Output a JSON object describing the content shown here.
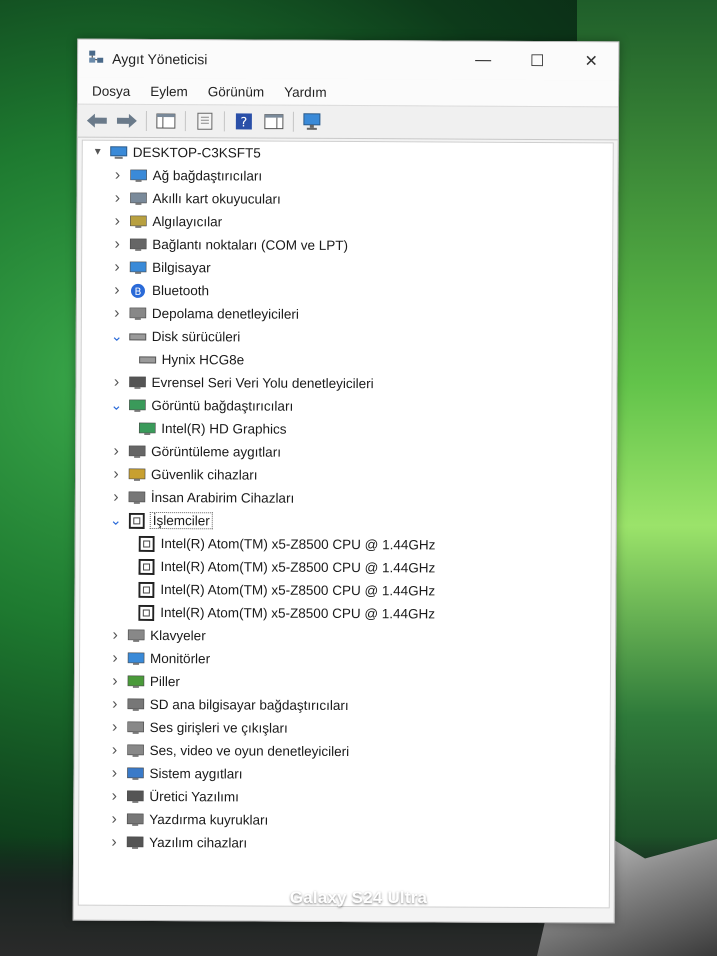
{
  "window": {
    "title": "Aygıt Yöneticisi"
  },
  "menu": [
    "Dosya",
    "Eylem",
    "Görünüm",
    "Yardım"
  ],
  "tree": {
    "root": "DESKTOP-C3KSFT5",
    "items": [
      {
        "label": "Ağ bağdaştırıcıları",
        "level": 1,
        "expanded": false,
        "icon": "network-adapter-icon"
      },
      {
        "label": "Akıllı kart okuyucuları",
        "level": 1,
        "expanded": false,
        "icon": "smart-card-reader-icon"
      },
      {
        "label": "Algılayıcılar",
        "level": 1,
        "expanded": false,
        "icon": "sensor-icon"
      },
      {
        "label": "Bağlantı noktaları (COM ve LPT)",
        "level": 1,
        "expanded": false,
        "icon": "port-icon"
      },
      {
        "label": "Bilgisayar",
        "level": 1,
        "expanded": false,
        "icon": "computer-icon"
      },
      {
        "label": "Bluetooth",
        "level": 1,
        "expanded": false,
        "icon": "bluetooth-icon"
      },
      {
        "label": "Depolama denetleyicileri",
        "level": 1,
        "expanded": false,
        "icon": "storage-controller-icon"
      },
      {
        "label": "Disk sürücüleri",
        "level": 1,
        "expanded": true,
        "icon": "disk-drive-icon"
      },
      {
        "label": "Hynix HCG8e",
        "level": 2,
        "icon": "disk-drive-icon"
      },
      {
        "label": "Evrensel Seri Veri Yolu denetleyicileri",
        "level": 1,
        "expanded": false,
        "icon": "usb-icon"
      },
      {
        "label": "Görüntü bağdaştırıcıları",
        "level": 1,
        "expanded": true,
        "icon": "display-adapter-icon"
      },
      {
        "label": "Intel(R) HD Graphics",
        "level": 2,
        "icon": "display-adapter-icon"
      },
      {
        "label": "Görüntüleme aygıtları",
        "level": 1,
        "expanded": false,
        "icon": "camera-icon"
      },
      {
        "label": "Güvenlik cihazları",
        "level": 1,
        "expanded": false,
        "icon": "security-device-icon"
      },
      {
        "label": "İnsan Arabirim Cihazları",
        "level": 1,
        "expanded": false,
        "icon": "hid-icon"
      },
      {
        "label": "İşlemciler",
        "level": 1,
        "expanded": true,
        "icon": "processor-icon",
        "selected": true
      },
      {
        "label": "Intel(R) Atom(TM) x5-Z8500  CPU @ 1.44GHz",
        "level": 2,
        "icon": "processor-icon"
      },
      {
        "label": "Intel(R) Atom(TM) x5-Z8500  CPU @ 1.44GHz",
        "level": 2,
        "icon": "processor-icon"
      },
      {
        "label": "Intel(R) Atom(TM) x5-Z8500  CPU @ 1.44GHz",
        "level": 2,
        "icon": "processor-icon"
      },
      {
        "label": "Intel(R) Atom(TM) x5-Z8500  CPU @ 1.44GHz",
        "level": 2,
        "icon": "processor-icon"
      },
      {
        "label": "Klavyeler",
        "level": 1,
        "expanded": false,
        "icon": "keyboard-icon"
      },
      {
        "label": "Monitörler",
        "level": 1,
        "expanded": false,
        "icon": "monitor-icon"
      },
      {
        "label": "Piller",
        "level": 1,
        "expanded": false,
        "icon": "battery-icon"
      },
      {
        "label": "SD ana bilgisayar bağdaştırıcıları",
        "level": 1,
        "expanded": false,
        "icon": "sd-host-icon"
      },
      {
        "label": "Ses girişleri ve çıkışları",
        "level": 1,
        "expanded": false,
        "icon": "audio-io-icon"
      },
      {
        "label": "Ses, video ve oyun denetleyicileri",
        "level": 1,
        "expanded": false,
        "icon": "sound-controller-icon"
      },
      {
        "label": "Sistem aygıtları",
        "level": 1,
        "expanded": false,
        "icon": "system-device-icon"
      },
      {
        "label": "Üretici Yazılımı",
        "level": 1,
        "expanded": false,
        "icon": "firmware-icon"
      },
      {
        "label": "Yazdırma kuyrukları",
        "level": 1,
        "expanded": false,
        "icon": "print-queue-icon"
      },
      {
        "label": "Yazılım cihazları",
        "level": 1,
        "expanded": false,
        "icon": "software-device-icon"
      }
    ]
  },
  "watermark": "Galaxy S24 Ultra"
}
